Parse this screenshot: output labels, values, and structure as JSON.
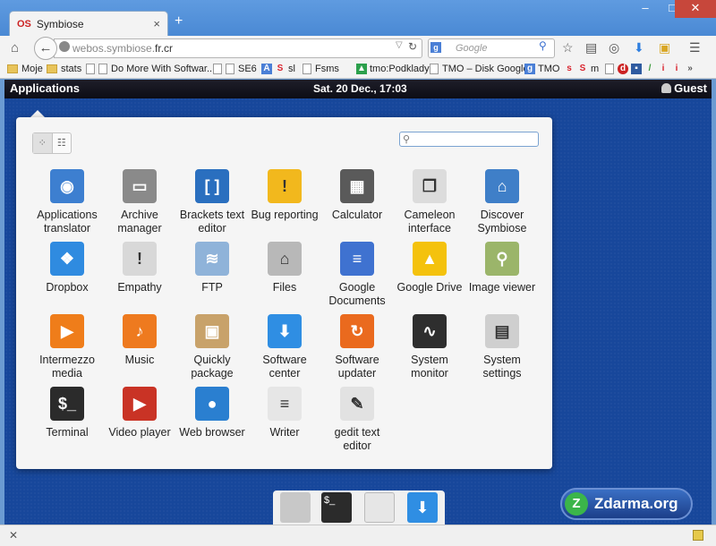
{
  "browser": {
    "tab_logo": "OS",
    "tab_title": "Symbiose",
    "tab_close": "×",
    "new_tab": "+",
    "url_domain": "webos.symbiose.",
    "url_tld": "fr.cr",
    "search_placeholder": "Google",
    "window_controls": [
      "–",
      "□",
      "✕"
    ]
  },
  "bookmarks": [
    {
      "label": "Moje",
      "kind": "folder"
    },
    {
      "label": "stats",
      "kind": "folder"
    },
    {
      "label": "Do More With Softwar...",
      "kind": "page"
    },
    {
      "label": "SE6",
      "kind": "page"
    },
    {
      "label": "sl",
      "kind": "icon",
      "color": "#d9232d"
    },
    {
      "label": "Fsms",
      "kind": "page"
    },
    {
      "label": "tmo:Podklady",
      "kind": "icon",
      "color": "#2ca04c"
    },
    {
      "label": "TMO – Disk Google",
      "kind": "page"
    },
    {
      "label": "TMO",
      "kind": "icon",
      "color": "#4a7fd6"
    },
    {
      "label": "m",
      "kind": "icon",
      "color": "#d9232d"
    }
  ],
  "topbar": {
    "applications": "Applications",
    "clock": "Sat. 20 Dec., 17:03",
    "user": "Guest"
  },
  "apps": [
    {
      "label": "Applications translator",
      "icon": "globe-icon",
      "color": "#3d7fd0"
    },
    {
      "label": "Archive manager",
      "icon": "archive-icon",
      "color": "#8a8a8a"
    },
    {
      "label": "Brackets text editor",
      "icon": "brackets-icon",
      "color": "#2a6fbf"
    },
    {
      "label": "Bug reporting",
      "icon": "warning-icon",
      "color": "#f2b81d"
    },
    {
      "label": "Calculator",
      "icon": "calculator-icon",
      "color": "#5a5a5a"
    },
    {
      "label": "Cameleon interface",
      "icon": "windows-icon",
      "color": "#dcdcdc"
    },
    {
      "label": "Discover Symbiose",
      "icon": "home-icon",
      "color": "#3f7fc8"
    },
    {
      "label": "Dropbox",
      "icon": "dropbox-icon",
      "color": "#2f8be0"
    },
    {
      "label": "Empathy",
      "icon": "chat-icon",
      "color": "#d8d8d8"
    },
    {
      "label": "FTP",
      "icon": "folder-network-icon",
      "color": "#8fb3d9"
    },
    {
      "label": "Files",
      "icon": "folder-home-icon",
      "color": "#b8b8b8"
    },
    {
      "label": "Google Documents",
      "icon": "document-icon",
      "color": "#3f72d0"
    },
    {
      "label": "Google Drive",
      "icon": "drive-icon",
      "color": "#f4c20d"
    },
    {
      "label": "Image viewer",
      "icon": "image-icon",
      "color": "#9bb56a"
    },
    {
      "label": "Intermezzo media",
      "icon": "media-icon",
      "color": "#ef7d1a"
    },
    {
      "label": "Music",
      "icon": "music-icon",
      "color": "#ee7a1f"
    },
    {
      "label": "Quickly package",
      "icon": "package-icon",
      "color": "#c8a26a"
    },
    {
      "label": "Software center",
      "icon": "download-icon",
      "color": "#2f8ee3"
    },
    {
      "label": "Software updater",
      "icon": "update-icon",
      "color": "#ea6a1e"
    },
    {
      "label": "System monitor",
      "icon": "monitor-icon",
      "color": "#2e2e2e"
    },
    {
      "label": "System settings",
      "icon": "settings-icon",
      "color": "#cfcfcf"
    },
    {
      "label": "Terminal",
      "icon": "terminal-icon",
      "color": "#2b2b2b"
    },
    {
      "label": "Video player",
      "icon": "video-icon",
      "color": "#c93325"
    },
    {
      "label": "Web browser",
      "icon": "browser-icon",
      "color": "#2a7fd0"
    },
    {
      "label": "Writer",
      "icon": "writer-icon",
      "color": "#e6e6e6"
    },
    {
      "label": "gedit text editor",
      "icon": "gedit-icon",
      "color": "#e2e2e2"
    }
  ],
  "dock": [
    "folder-home-icon",
    "terminal-icon",
    "gedit-icon",
    "download-icon"
  ],
  "watermark": "Zdarma.org",
  "status": {
    "close": "✕"
  }
}
